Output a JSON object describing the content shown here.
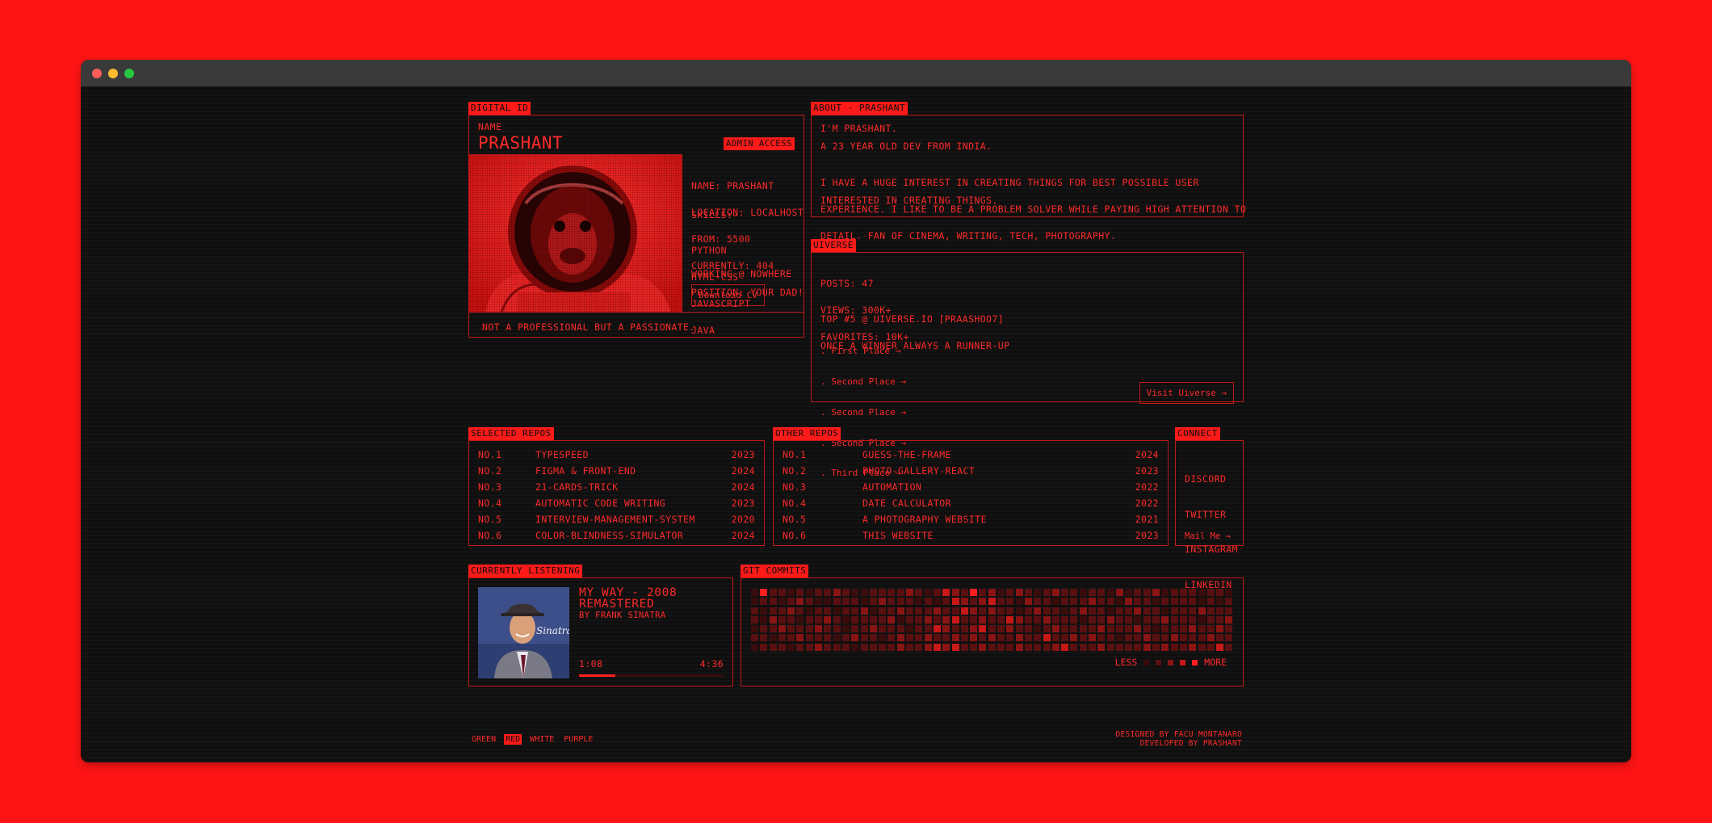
{
  "digital_id": {
    "tag": "DIGITAL ID",
    "name_label": "NAME",
    "name": "PRASHANT",
    "admin": "ADMIN ACCESS",
    "details": [
      "NAME: PRASHANT",
      "LOCATION: LOCALHOST",
      "FROM: 5500",
      "CURRENTLY: 404",
      "POSITION: YOUR DAD!"
    ],
    "skills_label": "SKILLS:-",
    "skills": [
      "PYTHON",
      "HTML-CSS",
      "JAVASCRIPT",
      "JAVA"
    ],
    "status": "WORKING @ NOWHERE",
    "cv_button": "Download CV",
    "tagline": "NOT A PROFESSIONAL BUT A PASSIONATE."
  },
  "about": {
    "tag": "ABOUT - PRASHANT",
    "p1": "I'M PRASHANT.",
    "p2": "A 23 YEAR OLD DEV FROM INDIA.",
    "p3": [
      "I HAVE A HUGE INTEREST IN CREATING THINGS FOR BEST POSSIBLE USER",
      "EXPERIENCE. I LIKE TO BE A PROBLEM SOLVER WHILE PAYING HIGH ATTENTION TO",
      "DETAIL. FAN OF CINEMA, WRITING, TECH, PHOTOGRAPHY."
    ],
    "p4": "INTERESTED IN CREATING THINGS."
  },
  "uiverse": {
    "tag": "UIVERSE",
    "stats": [
      "POSTS: 47",
      "VIEWS: 300K+",
      "FAVORITES: 10K+"
    ],
    "rank": [
      "TOP #5 @ UIVERSE.IO [PRAASHOO7]",
      "ONCE A WINNER ALWAYS A RUNNER-UP"
    ],
    "places": [
      ". First Place →",
      ". Second Place →",
      ". Second Place →",
      ". Second Place →",
      ". Third Place →"
    ],
    "visit": "Visit Uiverse →"
  },
  "selected_repos": {
    "tag": "SELECTED REPOS",
    "rows": [
      [
        "NO.1",
        "TYPESPEED",
        "2023"
      ],
      [
        "NO.2",
        "FIGMA & FRONT-END",
        "2024"
      ],
      [
        "NO.3",
        "21-CARDS-TRICK",
        "2024"
      ],
      [
        "NO.4",
        "AUTOMATIC CODE WRITING",
        "2023"
      ],
      [
        "NO.5",
        "INTERVIEW-MANAGEMENT-SYSTEM",
        "2020"
      ],
      [
        "NO.6",
        "COLOR-BLINDNESS-SIMULATOR",
        "2024"
      ]
    ]
  },
  "other_repos": {
    "tag": "OTHER REPOS",
    "rows": [
      [
        "NO.1",
        "GUESS-THE-FRAME",
        "2024"
      ],
      [
        "NO.2",
        "PHOTO-GALLERY-REACT",
        "2023"
      ],
      [
        "NO.3",
        "AUTOMATION",
        "2022"
      ],
      [
        "NO.4",
        "DATE CALCULATOR",
        "2022"
      ],
      [
        "NO.5",
        "A PHOTOGRAPHY WEBSITE",
        "2021"
      ],
      [
        "NO.6",
        "THIS WEBSITE",
        "2023"
      ]
    ]
  },
  "connect": {
    "tag": "CONNECT",
    "links": [
      "DISCORD",
      "TWITTER",
      "INSTAGRAM",
      "LINKEDIN"
    ],
    "mail": "Mail Me →"
  },
  "listening": {
    "tag": "CURRENTLY LISTENING",
    "title1": "MY WAY - 2008",
    "title2": "REMASTERED",
    "artist": "BY FRANK SINATRA",
    "elapsed": "1:08",
    "duration": "4:36",
    "progress": 0.25
  },
  "git": {
    "tag": "GIT COMMITS",
    "less": "LESS",
    "more": "MORE"
  },
  "chart_data": {
    "type": "heatmap",
    "rows": 7,
    "cols": 53,
    "scale": [
      "#3a0c0c",
      "#5a1010",
      "#8a1414",
      "#c81818",
      "#ff1f1f"
    ],
    "values": [
      [
        0,
        4,
        1,
        1,
        0,
        1,
        0,
        1,
        1,
        2,
        1,
        0,
        0,
        1,
        1,
        1,
        1,
        2,
        1,
        0,
        1,
        3,
        2,
        1,
        4,
        1,
        2,
        0,
        1,
        2,
        1,
        0,
        1,
        2,
        1,
        1,
        0,
        1,
        1,
        0,
        2,
        0,
        1,
        1,
        2,
        0,
        1,
        1,
        1,
        0,
        1,
        1,
        0
      ],
      [
        0,
        1,
        1,
        0,
        1,
        2,
        1,
        0,
        0,
        1,
        1,
        1,
        0,
        1,
        2,
        1,
        1,
        1,
        0,
        1,
        0,
        1,
        3,
        2,
        1,
        2,
        3,
        1,
        1,
        0,
        2,
        1,
        1,
        0,
        1,
        1,
        1,
        2,
        1,
        1,
        0,
        2,
        1,
        1,
        0,
        1,
        1,
        1,
        1,
        0,
        1,
        0,
        1
      ],
      [
        1,
        0,
        1,
        1,
        2,
        1,
        0,
        1,
        1,
        0,
        1,
        1,
        2,
        0,
        1,
        1,
        2,
        1,
        1,
        1,
        2,
        1,
        1,
        3,
        2,
        1,
        2,
        1,
        1,
        0,
        1,
        2,
        1,
        1,
        0,
        1,
        2,
        1,
        1,
        0,
        1,
        1,
        2,
        1,
        1,
        0,
        1,
        1,
        1,
        2,
        1,
        1,
        1
      ],
      [
        1,
        0,
        2,
        1,
        1,
        0,
        1,
        1,
        2,
        1,
        0,
        1,
        1,
        1,
        1,
        2,
        0,
        1,
        1,
        2,
        1,
        2,
        3,
        1,
        1,
        2,
        1,
        1,
        3,
        2,
        1,
        1,
        2,
        1,
        1,
        1,
        0,
        1,
        1,
        2,
        1,
        1,
        0,
        1,
        1,
        2,
        1,
        1,
        1,
        0,
        1,
        1,
        2
      ],
      [
        0,
        1,
        1,
        2,
        1,
        1,
        1,
        2,
        1,
        1,
        0,
        1,
        1,
        2,
        1,
        1,
        1,
        0,
        1,
        1,
        3,
        2,
        1,
        1,
        2,
        3,
        1,
        1,
        2,
        1,
        1,
        0,
        1,
        2,
        1,
        1,
        1,
        1,
        2,
        1,
        1,
        1,
        2,
        1,
        0,
        1,
        1,
        1,
        2,
        1,
        1,
        2,
        1
      ],
      [
        1,
        1,
        0,
        1,
        1,
        2,
        1,
        1,
        1,
        0,
        1,
        2,
        1,
        1,
        0,
        1,
        2,
        1,
        1,
        2,
        1,
        1,
        2,
        1,
        2,
        1,
        2,
        1,
        1,
        2,
        1,
        1,
        3,
        1,
        1,
        2,
        1,
        2,
        1,
        1,
        0,
        1,
        1,
        2,
        1,
        1,
        2,
        1,
        1,
        1,
        2,
        1,
        1
      ],
      [
        0,
        1,
        1,
        1,
        0,
        1,
        1,
        2,
        1,
        1,
        1,
        0,
        1,
        1,
        1,
        1,
        2,
        1,
        1,
        2,
        3,
        2,
        3,
        1,
        1,
        2,
        1,
        1,
        1,
        2,
        1,
        1,
        1,
        2,
        3,
        1,
        1,
        1,
        2,
        1,
        1,
        1,
        1,
        2,
        1,
        2,
        1,
        1,
        2,
        1,
        1,
        3,
        1
      ]
    ]
  }
}
